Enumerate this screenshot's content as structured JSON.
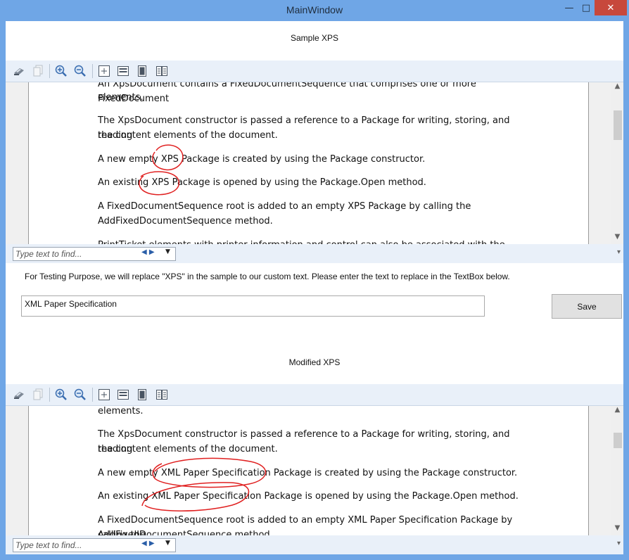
{
  "window": {
    "title": "MainWindow",
    "min": "—",
    "max": "□",
    "close": "✕"
  },
  "sample": {
    "label": "Sample XPS",
    "lines": [
      "An XpsDocument contains a FixedDocumentSequence that comprises one or more FixedDocument",
      "elements.",
      "The XpsDocument constructor is passed a reference to a Package for writing, storing, and reading",
      "the content elements of the document.",
      "A new empty XPS Package is created by using the Package constructor.",
      "An existing XPS Package is opened by using the Package.Open method.",
      "A FixedDocumentSequence root is added to an empty XPS Package by calling the",
      "AddFixedDocumentSequence method.",
      "PrintTicket elements with printer information and control can also be associated with the"
    ],
    "find_placeholder": "Type text to find..."
  },
  "instruction": "For Testing Purpose, we will replace \"XPS\" in the sample to our custom text. Please enter the text to replace in the TextBox below.",
  "replace_input": {
    "value": "XML Paper Specification"
  },
  "save_label": "Save",
  "modified": {
    "label": "Modified XPS",
    "lines": [
      "elements.",
      "The XpsDocument constructor is passed a reference to a Package for writing, storing, and reading",
      "the content elements of the document.",
      "A new empty XML Paper Specification Package is created by using the Package constructor.",
      "An existing XML Paper Specification Package is opened by using the Package.Open method.",
      "A FixedDocumentSequence root is added to an empty XML Paper Specification Package by calling the",
      "AddFixedDocumentSequence method."
    ],
    "find_placeholder": "Type text to find..."
  },
  "toolbar_icons": [
    "print-icon",
    "copy-icon",
    "zoom-in-icon",
    "zoom-out-icon",
    "actual-size-icon",
    "page-width-icon",
    "whole-page-icon",
    "two-pages-icon"
  ],
  "annotation_color": "#e02020"
}
